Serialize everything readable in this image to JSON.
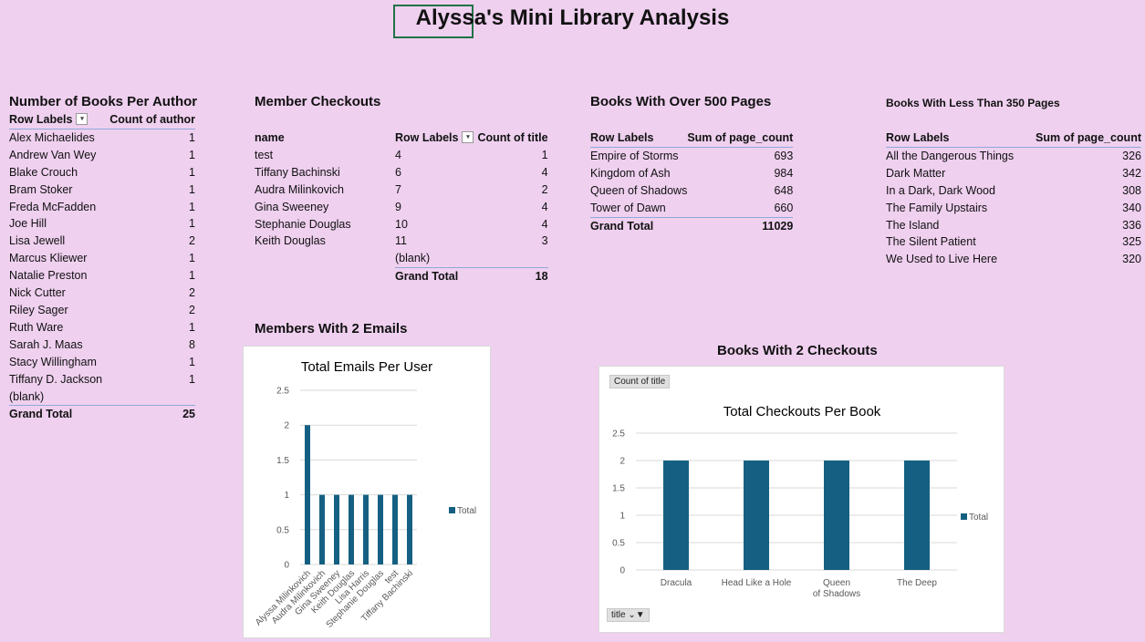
{
  "page_title": "Alyssa's Mini Library Analysis",
  "authors": {
    "title": "Number of Books Per Author",
    "col1": "Row Labels",
    "col2": "Count of author",
    "rows": [
      {
        "label": "Alex Michaelides",
        "value": "1"
      },
      {
        "label": "Andrew Van Wey",
        "value": "1"
      },
      {
        "label": "Blake Crouch",
        "value": "1"
      },
      {
        "label": "Bram Stoker",
        "value": "1"
      },
      {
        "label": "Freda McFadden",
        "value": "1"
      },
      {
        "label": "Joe Hill",
        "value": "1"
      },
      {
        "label": "Lisa Jewell",
        "value": "2"
      },
      {
        "label": "Marcus Kliewer",
        "value": "1"
      },
      {
        "label": "Natalie Preston",
        "value": "1"
      },
      {
        "label": "Nick Cutter",
        "value": "2"
      },
      {
        "label": "Riley Sager",
        "value": "2"
      },
      {
        "label": "Ruth Ware",
        "value": "1"
      },
      {
        "label": "Sarah J. Maas",
        "value": "8"
      },
      {
        "label": "Stacy Willingham",
        "value": "1"
      },
      {
        "label": "Tiffany D. Jackson",
        "value": "1"
      },
      {
        "label": "(blank)",
        "value": ""
      }
    ],
    "total_label": "Grand Total",
    "total_value": "25"
  },
  "checkouts": {
    "title": "Member Checkouts",
    "names_header": "name",
    "names": [
      "test",
      "Tiffany Bachinski",
      "Audra Milinkovich",
      "Gina Sweeney",
      "Stephanie Douglas",
      "Keith Douglas"
    ],
    "col1": "Row Labels",
    "col2": "Count of title",
    "rows": [
      {
        "label": "4",
        "value": "1"
      },
      {
        "label": "6",
        "value": "4"
      },
      {
        "label": "7",
        "value": "2"
      },
      {
        "label": "9",
        "value": "4"
      },
      {
        "label": "10",
        "value": "4"
      },
      {
        "label": "11",
        "value": "3"
      },
      {
        "label": "(blank)",
        "value": ""
      }
    ],
    "total_label": "Grand Total",
    "total_value": "18"
  },
  "over500": {
    "title": "Books With Over 500 Pages",
    "col1": "Row Labels",
    "col2": "Sum of page_count",
    "rows": [
      {
        "label": "Empire of Storms",
        "value": "693"
      },
      {
        "label": "Kingdom of Ash",
        "value": "984"
      },
      {
        "label": "Queen of Shadows",
        "value": "648"
      },
      {
        "label": "Tower of Dawn",
        "value": "660"
      }
    ],
    "total_label": "Grand Total",
    "total_value": "11029"
  },
  "under350": {
    "title": "Books With Less Than 350 Pages",
    "col1": "Row Labels",
    "col2": "Sum of page_count",
    "rows": [
      {
        "label": "All the Dangerous Things",
        "value": "326"
      },
      {
        "label": "Dark Matter",
        "value": "342"
      },
      {
        "label": "In a Dark, Dark Wood",
        "value": "308"
      },
      {
        "label": "The Family Upstairs",
        "value": "340"
      },
      {
        "label": "The Island",
        "value": "336"
      },
      {
        "label": "The Silent Patient",
        "value": "325"
      },
      {
        "label": "We Used to Live Here",
        "value": "320"
      }
    ]
  },
  "emails": {
    "title": "Members With 2 Emails"
  },
  "two_checkouts": {
    "title": "Books With 2 Checkouts",
    "value_field_button": "Count of title",
    "axis_field_button": "title"
  },
  "colors": {
    "bar": "#156082",
    "background": "#efd0ef"
  },
  "chart_data": [
    {
      "type": "bar",
      "title": "Total Emails Per User",
      "categories": [
        "Alyssa Milinkovich",
        "Audra Milinkovich",
        "Gina Sweeney",
        "Keith Douglas",
        "Lisa Harris",
        "Stephanie Douglas",
        "test",
        "Tiffany Bachinski"
      ],
      "series": [
        {
          "name": "Total",
          "values": [
            2,
            1,
            1,
            1,
            1,
            1,
            1,
            1
          ]
        }
      ],
      "ylim": [
        0,
        2.5
      ],
      "yticks": [
        "0",
        "0.5",
        "1",
        "1.5",
        "2",
        "2.5"
      ],
      "grid": true,
      "legend": "right"
    },
    {
      "type": "bar",
      "title": "Total Checkouts Per Book",
      "categories": [
        "Dracula",
        "Head Like a Hole",
        "Queen of Shadows",
        "The Deep"
      ],
      "series": [
        {
          "name": "Total",
          "values": [
            2,
            2,
            2,
            2
          ]
        }
      ],
      "ylim": [
        0,
        2.5
      ],
      "yticks": [
        "0",
        "0.5",
        "1",
        "1.5",
        "2",
        "2.5"
      ],
      "grid": true,
      "legend": "right"
    }
  ]
}
